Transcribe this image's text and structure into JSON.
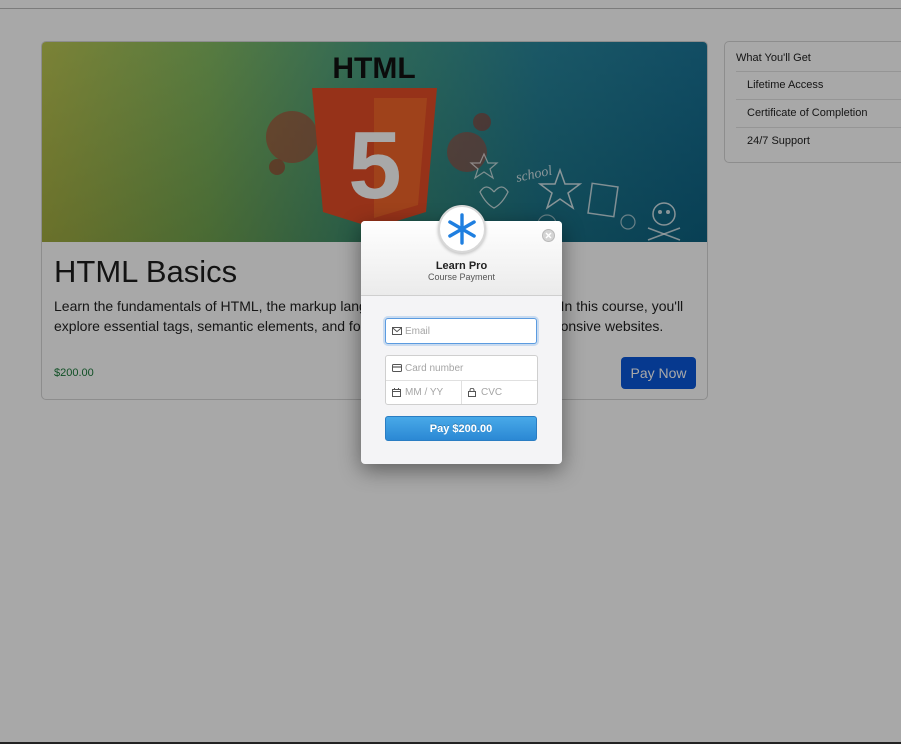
{
  "course": {
    "banner_heading": "HTML",
    "banner_number": "5",
    "banner_doodle": "school",
    "title": "HTML Basics",
    "description": "Learn the fundamentals of HTML, the markup language used to build web pages. In this course, you'll explore essential tags, semantic elements, and forms to build accessible and responsive websites.",
    "price": "$200.00",
    "pay_now_label": "Pay Now"
  },
  "sidebar": {
    "title": "What You'll Get",
    "items": [
      {
        "label": "Lifetime Access"
      },
      {
        "label": "Certificate of Completion"
      },
      {
        "label": "24/7 Support"
      }
    ]
  },
  "modal": {
    "brand_name": "Learn Pro",
    "brand_subtitle": "Course Payment",
    "email_placeholder": "Email",
    "card_placeholder": "Card number",
    "expiry_placeholder": "MM / YY",
    "cvc_placeholder": "CVC",
    "pay_button_label": "Pay $200.00"
  },
  "colors": {
    "accent": "#0a57d9",
    "price": "#1a7a3a",
    "pay_button": "#2b88d4",
    "html5_orange": "#e44d26"
  },
  "icons": {
    "logo": "asterisk-icon",
    "close": "close-icon",
    "email": "mail-icon",
    "card": "credit-card-icon",
    "expiry": "calendar-icon",
    "cvc": "lock-icon"
  }
}
